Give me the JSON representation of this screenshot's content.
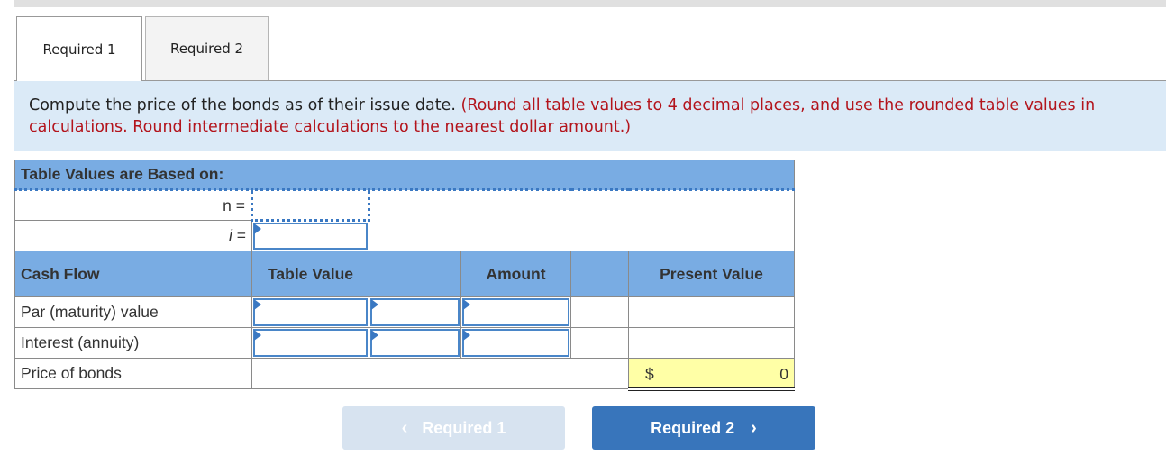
{
  "tabs": [
    {
      "label": "Required 1",
      "active": true
    },
    {
      "label": "Required 2",
      "active": false
    }
  ],
  "instructions": {
    "main": "Compute the price of the bonds as of their issue date. ",
    "note": "(Round all table values to 4 decimal places, and use the rounded table values in calculations. Round intermediate calculations to the nearest dollar amount.)"
  },
  "table": {
    "title": "Table Values are Based on:",
    "n_label": "n =",
    "i_label": "i",
    "i_eq": " =",
    "n_value": "",
    "i_value": "",
    "columns": {
      "cash_flow": "Cash Flow",
      "table_value": "Table Value",
      "amount": "Amount",
      "present_value": "Present Value"
    },
    "rows": [
      {
        "label": "Par (maturity) value",
        "table_value": "",
        "col3": "",
        "amount": "",
        "present_value": ""
      },
      {
        "label": "Interest (annuity)",
        "table_value": "",
        "col3": "",
        "amount": "",
        "present_value": ""
      }
    ],
    "total": {
      "label": "Price of bonds",
      "currency": "$",
      "value": "0"
    }
  },
  "nav": {
    "prev_label": "Required 1",
    "next_label": "Required 2",
    "prev_chevron": "‹",
    "next_chevron": "›"
  },
  "colors": {
    "header_blue": "#79ace3",
    "instruction_bg": "#dbeaf7",
    "note_red": "#b3141c",
    "next_button": "#3875bb",
    "prev_button_disabled": "#d7e3f0",
    "total_highlight": "#ffffa6"
  }
}
